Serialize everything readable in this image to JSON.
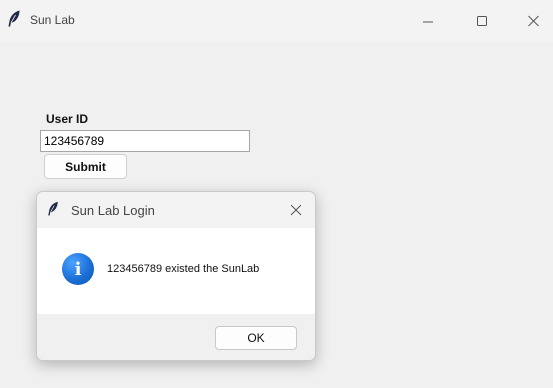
{
  "window": {
    "title": "Sun Lab",
    "icon": "feather-icon"
  },
  "form": {
    "userid_label": "User ID",
    "userid_value": "123456789",
    "submit_label": "Submit"
  },
  "dialog": {
    "title": "Sun Lab Login",
    "icon": "feather-icon",
    "message_icon": "info-icon",
    "message_icon_glyph": "i",
    "message": "123456789 existed the SunLab",
    "ok_label": "OK"
  },
  "colors": {
    "info_blue": "#1b6fd6",
    "window_bg": "#f0f0f0",
    "dialog_body_bg": "#ffffff"
  }
}
